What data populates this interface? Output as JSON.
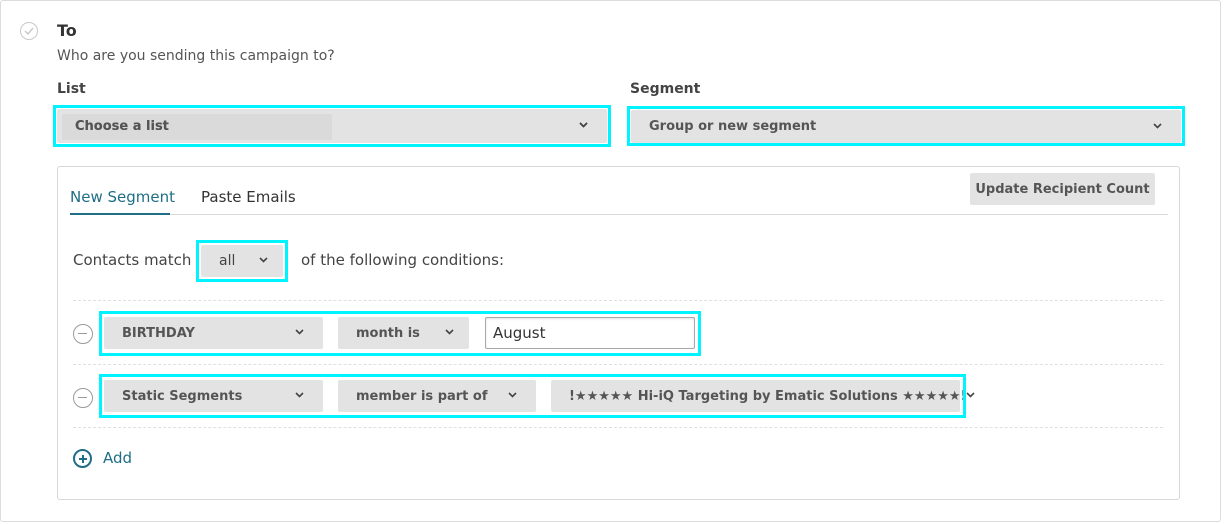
{
  "section": {
    "title": "To",
    "subtitle": "Who are you sending this campaign to?"
  },
  "list_field": {
    "label": "List",
    "value": "Choose a list"
  },
  "segment_field": {
    "label": "Segment",
    "value": "Group or new segment"
  },
  "panel": {
    "tabs": [
      {
        "label": "New Segment",
        "active": true
      },
      {
        "label": "Paste Emails",
        "active": false
      }
    ],
    "update_button_label": "Update Recipient Count",
    "match": {
      "prefix": "Contacts match",
      "value": "all",
      "suffix": "of the following conditions:"
    },
    "conditions": [
      {
        "field": "BIRTHDAY",
        "operator": "month is",
        "value": "August"
      },
      {
        "field": "Static Segments",
        "operator": "member is part of",
        "value": "!★★★★★ Hi-iQ Targeting by Ematic Solutions ★★★★★!"
      }
    ],
    "add_label": "Add"
  },
  "colors": {
    "accent": "#1f6e86",
    "highlight": "#00f4ff",
    "select_bg": "#e3e3e3"
  },
  "icons": [
    "check-icon",
    "chevron-down-icon",
    "remove-icon",
    "add-icon"
  ]
}
